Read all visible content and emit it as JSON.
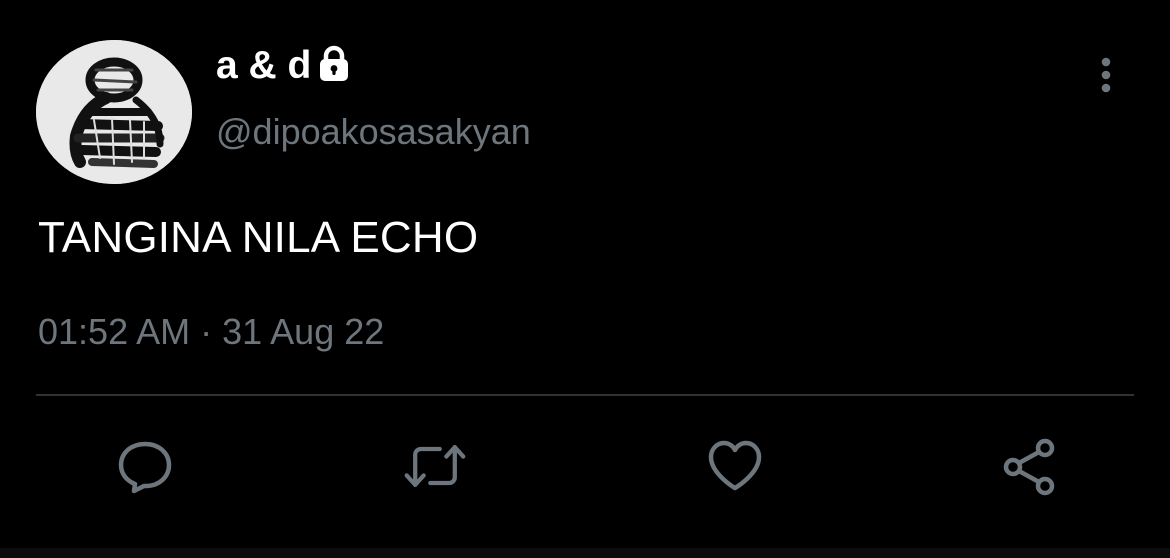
{
  "tweet": {
    "display_name": "a & d",
    "handle": "@dipoakosasakyan",
    "text": "TANGINA NILA ECHO",
    "timestamp": "01:52 AM · 31 Aug 22",
    "protected": true
  },
  "icons": {
    "lock": "lock-icon",
    "more": "vertical-ellipsis-icon",
    "reply": "comment-bubble-icon",
    "retweet": "retweet-icon",
    "like": "heart-icon",
    "share": "share-icon"
  },
  "colors": {
    "background": "#000000",
    "primary_text": "#ffffff",
    "secondary_text": "#6e767d",
    "divider": "#2f3336",
    "icon": "#6e767d"
  }
}
